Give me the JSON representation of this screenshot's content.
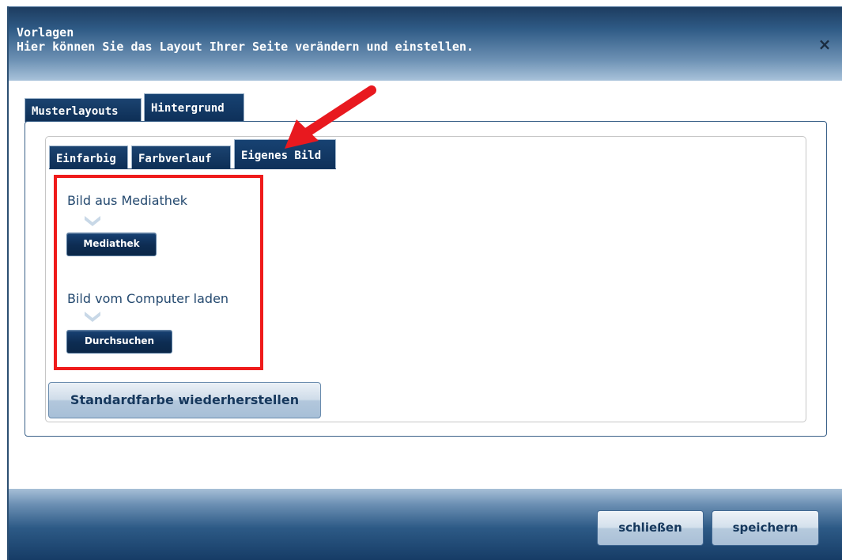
{
  "dialog": {
    "title": "Vorlagen",
    "subtitle": "Hier können Sie das Layout Ihrer Seite verändern und einstellen.",
    "close_symbol": "×"
  },
  "tabs": [
    {
      "label": "Musterlayouts",
      "active": false
    },
    {
      "label": "Hintergrund",
      "active": true
    }
  ],
  "subtabs": [
    {
      "label": "Einfarbig",
      "active": false
    },
    {
      "label": "Farbverlauf",
      "active": false
    },
    {
      "label": "Eigenes Bild",
      "active": true
    }
  ],
  "content": {
    "media_label": "Bild aus Mediathek",
    "media_button": "Mediathek",
    "computer_label": "Bild vom Computer laden",
    "browse_button": "Durchsuchen",
    "reset_button": "Standardfarbe wiederherstellen"
  },
  "footer": {
    "close_button": "schließen",
    "save_button": "speichern"
  },
  "colors": {
    "primary": "#133761",
    "highlight": "#ef1b1b",
    "arrow": "#e8191f"
  },
  "icons": {
    "close": "close-icon",
    "chevron": "chevron-down-icon",
    "arrow": "red-arrow-icon"
  }
}
